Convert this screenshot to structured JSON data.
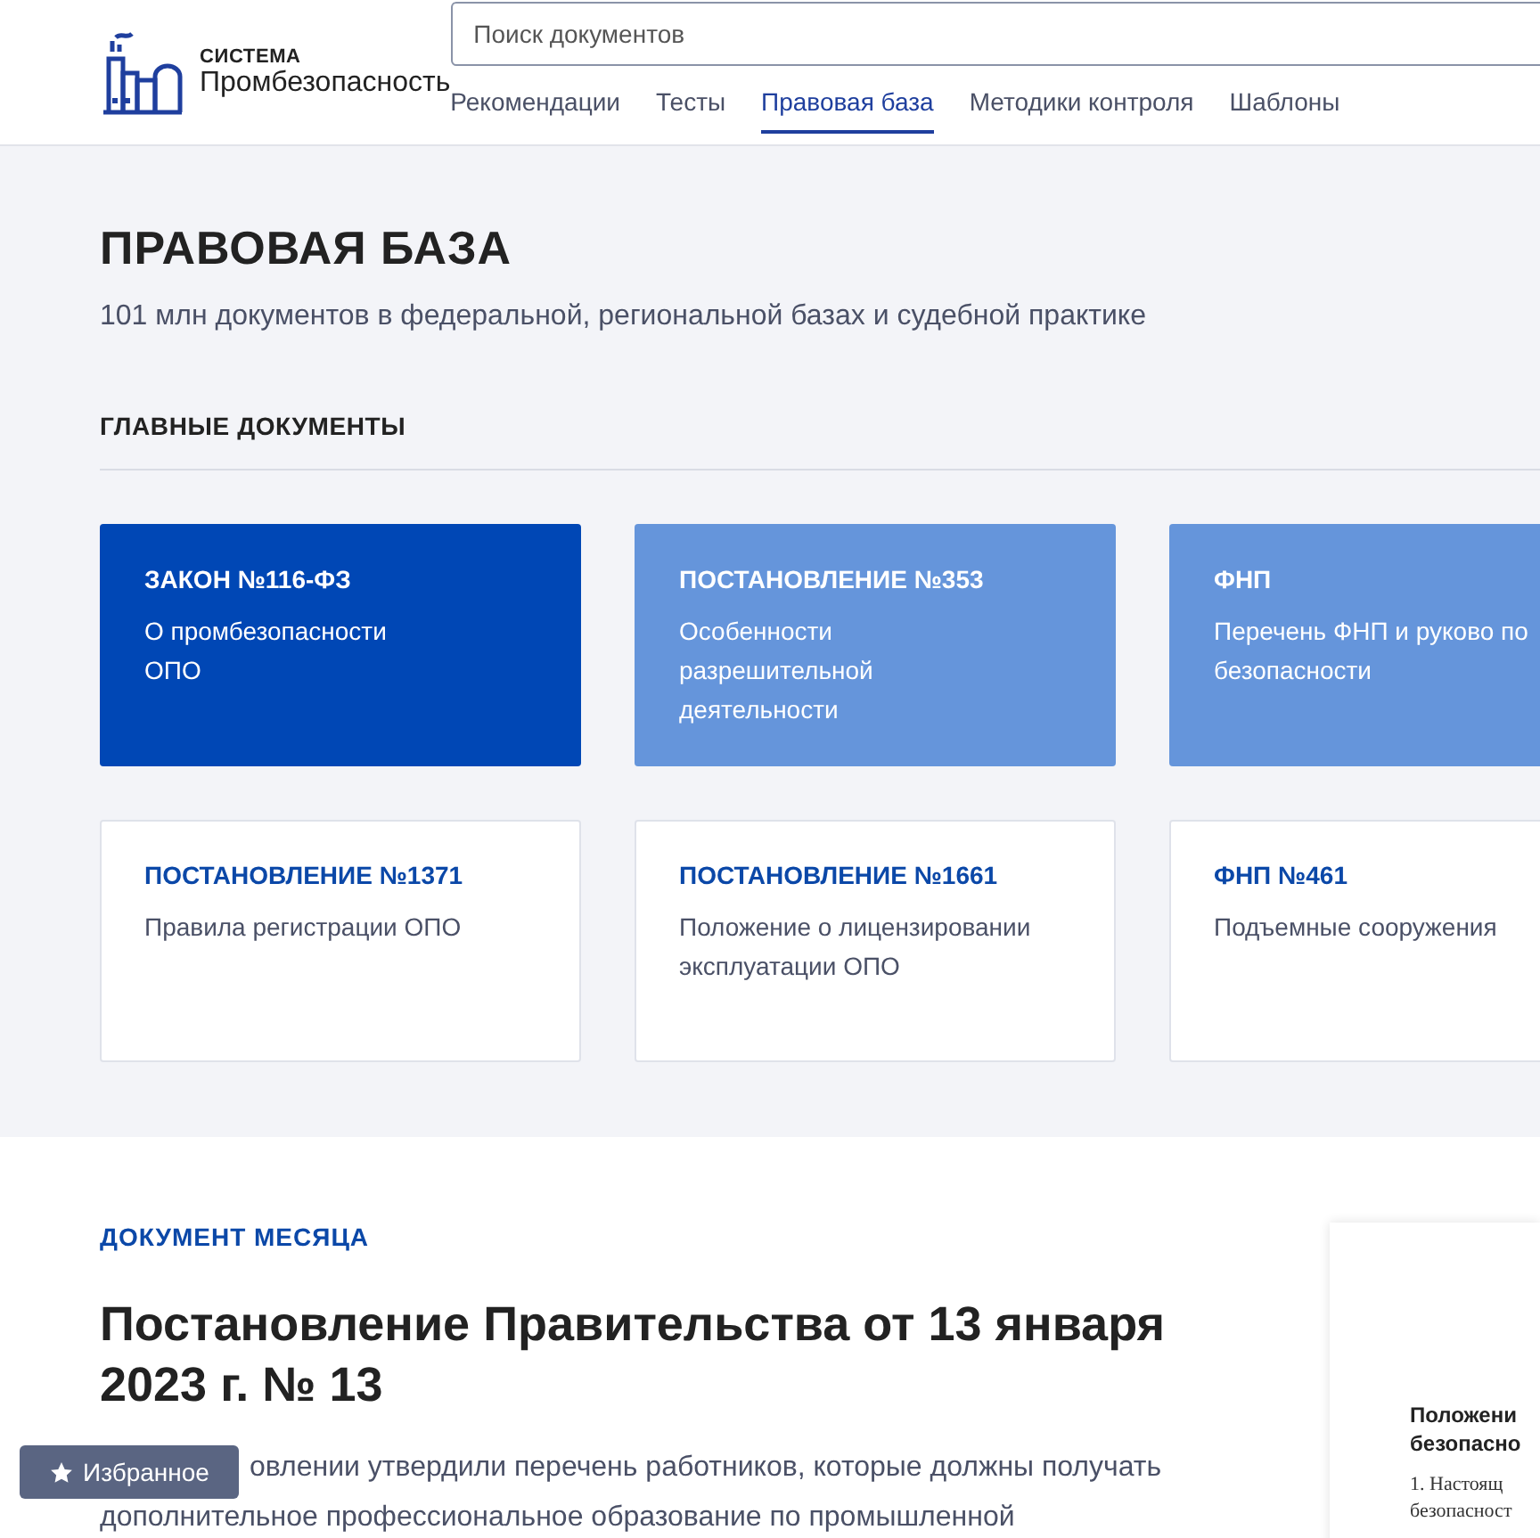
{
  "logo": {
    "overline": "СИСТЕМА",
    "name": "Промбезопасность"
  },
  "search": {
    "placeholder": "Поиск документов"
  },
  "nav": [
    {
      "label": "Рекомендации",
      "selected": false
    },
    {
      "label": "Тесты",
      "selected": false
    },
    {
      "label": "Правовая база",
      "selected": true
    },
    {
      "label": "Методики контроля",
      "selected": false
    },
    {
      "label": "Шаблоны",
      "selected": false
    }
  ],
  "page": {
    "title": "ПРАВОВАЯ БАЗА",
    "subtitle": "101 млн документов в федеральной, региональной базах и судебной практике"
  },
  "main_documents": {
    "heading": "ГЛАВНЫЕ ДОКУМЕНТЫ",
    "cards": [
      {
        "kind": "dark",
        "title": "ЗАКОН №116-ФЗ",
        "text": "О промбезопасности ОПО"
      },
      {
        "kind": "light",
        "title": "ПОСТАНОВЛЕНИЕ №353",
        "text": "Особенности разрешительной деятельности"
      },
      {
        "kind": "light",
        "title": "ФНП",
        "text": "Перечень ФНП и руково по безопасности"
      },
      {
        "kind": "outline",
        "title": "ПОСТАНОВЛЕНИЕ №1371",
        "text": "Правила регистрации ОПО"
      },
      {
        "kind": "outline",
        "title": "ПОСТАНОВЛЕНИЕ №1661",
        "text": "Положение о лицензировании эксплуатации ОПО"
      },
      {
        "kind": "outline",
        "title": "ФНП №461",
        "text": "Подъемные сооружения"
      }
    ]
  },
  "document_of_month": {
    "label": "ДОКУМЕНТ МЕСЯЦА",
    "title": "Постановление Правительства от 13 января 2023 г. № 13",
    "description_lines": [
      "овлении утвердили перечень работников, которые должны получать",
      "дополнительное профессиональное образование по промышленной"
    ],
    "preview": {
      "heading_lines": [
        "Положени",
        "безопасно"
      ],
      "body_lines": [
        "1.  Настоящ",
        "безопасност"
      ]
    }
  },
  "favorites_button": {
    "label": "Избранное"
  }
}
